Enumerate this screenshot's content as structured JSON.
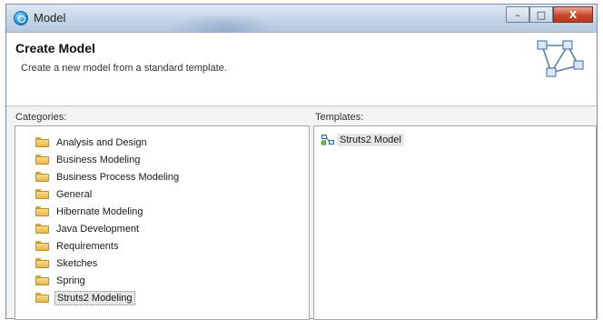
{
  "window": {
    "title": "Model",
    "buttons": {
      "minimize": "–",
      "maximize": "□",
      "close": "X"
    }
  },
  "banner": {
    "title": "Create Model",
    "description": "Create a new model from a standard template.",
    "icon": "model-graph-icon"
  },
  "categories": {
    "label": "Categories:",
    "items": [
      {
        "label": "Analysis and Design",
        "icon": "folder-icon"
      },
      {
        "label": "Business Modeling",
        "icon": "folder-icon"
      },
      {
        "label": "Business Process Modeling",
        "icon": "folder-icon"
      },
      {
        "label": "General",
        "icon": "folder-icon"
      },
      {
        "label": "Hibernate Modeling",
        "icon": "folder-icon"
      },
      {
        "label": "Java Development",
        "icon": "folder-icon"
      },
      {
        "label": "Requirements",
        "icon": "folder-icon"
      },
      {
        "label": "Sketches",
        "icon": "folder-icon"
      },
      {
        "label": "Spring",
        "icon": "folder-icon"
      },
      {
        "label": "Struts2 Modeling",
        "icon": "folder-icon",
        "selected": true
      }
    ]
  },
  "templates": {
    "label": "Templates:",
    "items": [
      {
        "label": "Struts2 Model",
        "icon": "model-icon",
        "selected": true
      }
    ]
  },
  "colors": {
    "titlebar": "#c4d4e7",
    "close_button": "#c8472d",
    "folder": "#e7b64a",
    "selection": "#e6e6e6"
  }
}
